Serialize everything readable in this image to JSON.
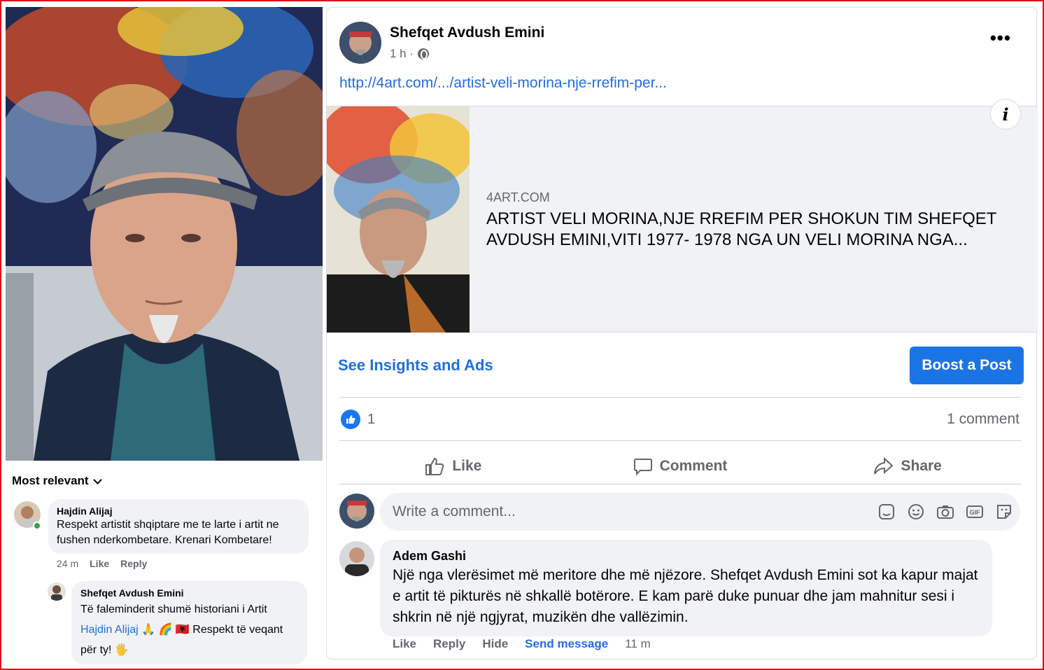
{
  "sort_label": "Most relevant",
  "left_comments": [
    {
      "author": "Hajdin Alijaj",
      "text": "Respekt artistit shqiptare me te larte i artit ne fushen  nderkombetare. Krenari Kombetare!",
      "time": "24 m",
      "like": "Like",
      "reply": "Reply"
    },
    {
      "author": "Shefqet Avdush Emini",
      "text_line1": "Të faleminderit shumë historiani i Artit",
      "mention": "Hajdin Alijaj",
      "emojis": "🙏 🌈 🇦🇱",
      "text_line2": "Respekt të veqant",
      "text_line3": "për ty!",
      "emoji_end": "🖐"
    }
  ],
  "post": {
    "author": "Shefqet Avdush Emini",
    "time": "1 h ·",
    "link": "http://4art.com/.../artist-veli-morina-nje-rrefim-per...",
    "more": "•••",
    "preview": {
      "domain": "4ART.COM",
      "title": "ARTIST VELI MORINA,NJE RREFIM PER SHOKUN TIM SHEFQET AVDUSH EMINI,VITI 1977- 1978 NGA UN VELI MORINA NGA...",
      "info": "i"
    },
    "insights": "See Insights and Ads",
    "boost": "Boost a Post",
    "likes": "1",
    "comments_count": "1 comment",
    "actions": {
      "like": "Like",
      "comment": "Comment",
      "share": "Share"
    },
    "composer_placeholder": "Write a comment...",
    "comment": {
      "author": "Adem Gashi",
      "text": "Një nga vlerësimet më meritore dhe më njëzore. Shefqet Avdush Emini sot ka kapur majat e artit të pikturës në shkallë botërore. E kam parë duke punuar dhe jam mahnitur sesi i shkrin në një ngjyrat, muzikën dhe vallëzimin.",
      "like": "Like",
      "reply": "Reply",
      "hide": "Hide",
      "send_message": "Send message",
      "time": "11 m"
    }
  },
  "colors": {
    "accent": "#1b74e4",
    "link": "#216fdb",
    "frame": "#e0101a"
  },
  "icons": [
    "chevron-down-icon",
    "globe-icon",
    "more-icon",
    "info-icon",
    "like-badge-icon",
    "thumbs-up-icon",
    "comment-icon",
    "share-icon",
    "sticker-icon",
    "emoji-icon",
    "camera-icon",
    "gif-icon",
    "avatar-sticker-icon"
  ]
}
